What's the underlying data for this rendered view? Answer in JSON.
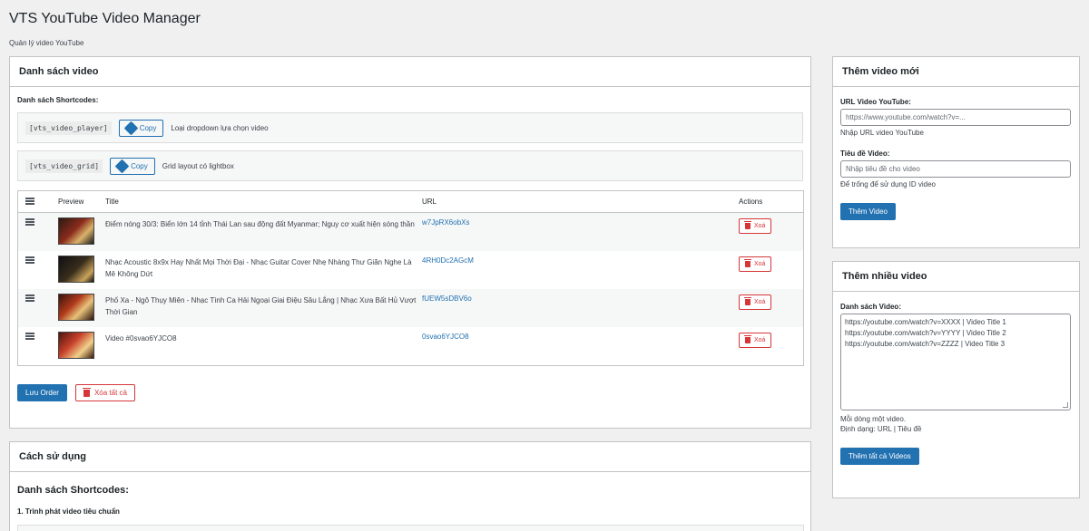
{
  "page": {
    "title": "VTS YouTube Video Manager",
    "subtitle": "Quản lý video YouTube"
  },
  "video_list": {
    "heading": "Danh sách video",
    "shortcodes_label": "Danh sách Shortcodes:",
    "shortcodes": [
      {
        "code": "[vts_video_player]",
        "copy_label": "Copy",
        "description": "Loại dropdown lựa chọn video"
      },
      {
        "code": "[vts_video_grid]",
        "copy_label": "Copy",
        "description": "Grid layout có lightbox"
      }
    ],
    "columns": {
      "preview": "Preview",
      "title": "Title",
      "url": "URL",
      "actions": "Actions"
    },
    "rows": [
      {
        "title": "Điểm nóng 30/3: Biển lớn 14 tỉnh Thái Lan sau động đất Myanmar; Nguy cơ xuất hiện sóng thần",
        "url": "w7JpRX6obXs",
        "delete_label": "Xoá"
      },
      {
        "title": "Nhạc Acoustic 8x9x Hay Nhất Mọi Thời Đại - Nhạc Guitar Cover Nhẹ Nhàng Thư Giãn Nghe Là Mê Không Dứt",
        "url": "4RH0Dc2AGcM",
        "delete_label": "Xoá"
      },
      {
        "title": "Phố Xa - Ngô Thụy Miên - Nhạc Tình Ca Hải Ngoại Giai Điệu Sâu Lắng | Nhạc Xưa Bất Hủ Vượt Thời Gian",
        "url": "fUEW5sDBV6o",
        "delete_label": "Xoá"
      },
      {
        "title": "Video #0svao6YJCO8",
        "url": "0svao6YJCO8",
        "delete_label": "Xoá"
      }
    ],
    "save_order_label": "Lưu Order",
    "delete_all_label": "Xóa tất cả"
  },
  "usage": {
    "heading": "Cách sử dụng",
    "subheading": "Danh sách Shortcodes:",
    "item1": "1. Trình phát video tiêu chuẩn"
  },
  "add_video": {
    "heading": "Thêm video mới",
    "url_label": "URL Video YouTube:",
    "url_placeholder": "https://www.youtube.com/watch?v=...",
    "url_hint": "Nhập URL video YouTube",
    "title_label": "Tiêu đề Video:",
    "title_placeholder": "Nhập tiêu đề cho video",
    "title_hint": "Để trống để sử dụng ID video",
    "submit_label": "Thêm Video"
  },
  "add_multiple": {
    "heading": "Thêm nhiều video",
    "list_label": "Danh sách Video:",
    "lines": [
      "https://youtube.com/watch?v=XXXX | Video Title 1",
      "https://youtube.com/watch?v=YYYY | Video Title 2",
      "https://youtube.com/watch?v=ZZZZ | Video Title 3"
    ],
    "hint1": "Mỗi dòng một video.",
    "hint2": "Định dạng: URL | Tiêu đề",
    "submit_label": "Thêm tất cả Videos"
  },
  "colors": {
    "primary": "#2271b1",
    "danger": "#d63638",
    "border": "#c3c4c7",
    "background": "#f0f0f1"
  }
}
